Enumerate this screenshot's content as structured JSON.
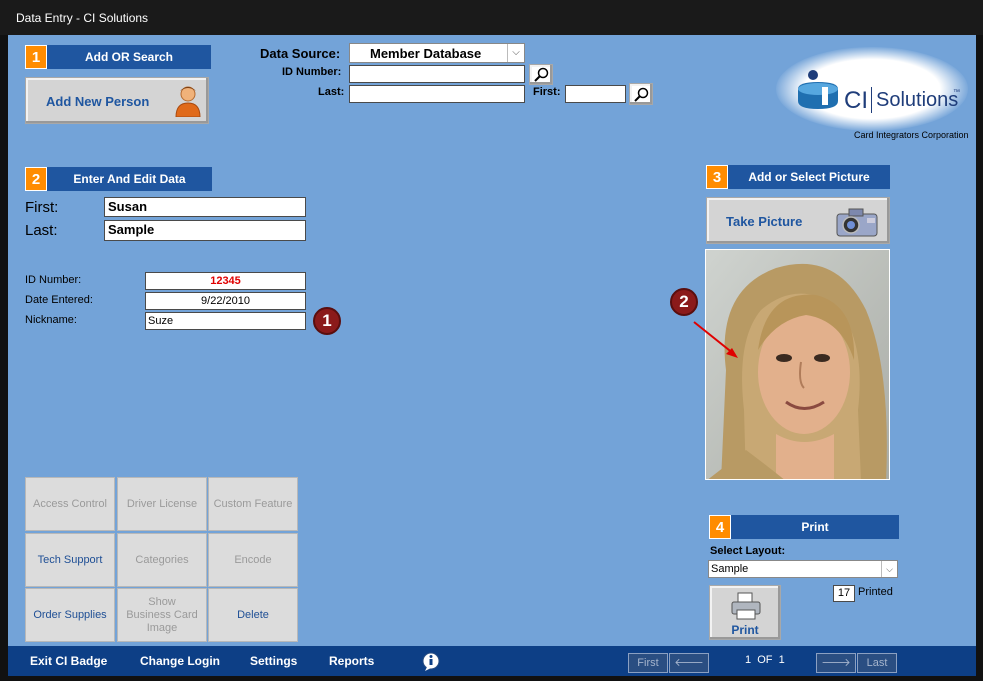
{
  "window": {
    "title": "Data Entry - CI Solutions"
  },
  "section1": {
    "num": "1",
    "title": "Add  OR  Search",
    "add_new_label": "Add New Person"
  },
  "search": {
    "datasource_label": "Data Source:",
    "datasource_value": "Member Database",
    "id_label": "ID Number:",
    "id_value": "",
    "last_label": "Last:",
    "last_value": "",
    "first_label": "First:",
    "first_value": ""
  },
  "logo": {
    "brand_ci": "CI",
    "brand_solutions": "Solutions",
    "tm": "™",
    "company": "Card Integrators Corporation"
  },
  "section2": {
    "num": "2",
    "title": "Enter  And  Edit  Data",
    "first_label": "First:",
    "first_value": "Susan",
    "last_label": "Last:",
    "last_value": "Sample",
    "id_label": "ID Number:",
    "id_value": "12345",
    "date_label": "Date Entered:",
    "date_value": "9/22/2010",
    "nick_label": "Nickname:",
    "nick_value": "Suze",
    "callout1": "1"
  },
  "section3": {
    "num": "3",
    "title": "Add or Select Picture",
    "take_picture_label": "Take Picture",
    "callout2": "2"
  },
  "section4": {
    "num": "4",
    "title": "Print",
    "layout_label": "Select Layout:",
    "layout_value": "Sample",
    "printed_count": "17",
    "printed_label": "Printed",
    "print_label": "Print"
  },
  "buttons": {
    "access_control": "Access Control",
    "driver_license": "Driver License",
    "custom_feature": "Custom Feature",
    "tech_support": "Tech Support",
    "categories": "Categories",
    "encode": "Encode",
    "order_supplies": "Order Supplies",
    "show_business": "Show Business Card Image",
    "delete": "Delete"
  },
  "footer": {
    "exit": "Exit CI Badge",
    "change_login": "Change Login",
    "settings": "Settings",
    "reports": "Reports",
    "nav_first": "First",
    "nav_prev": "🡐",
    "record": "1  OF  1",
    "nav_next": "🡒",
    "nav_last": "Last"
  },
  "colors": {
    "background": "#73a3d8",
    "header_blue": "#1f56a0",
    "accent_orange": "#ff8c00",
    "footer_blue": "#0d3f86",
    "callout": "#8b1a1a",
    "id_red": "#e00000"
  }
}
